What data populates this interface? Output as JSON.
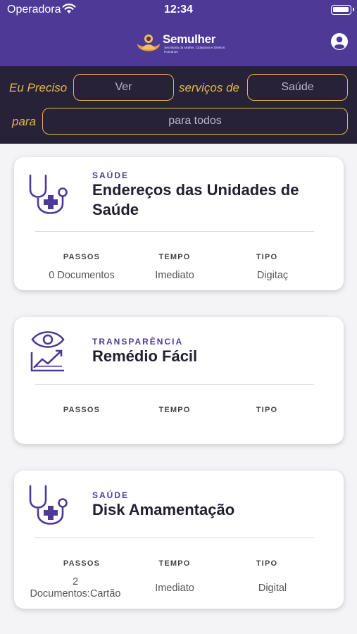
{
  "status_bar": {
    "carrier": "Operadora",
    "time": "12:34"
  },
  "header": {
    "logo_title": "Semulher",
    "logo_subtitle": "Secretaria da Mulher, Cidadania e Direitos Humanos",
    "brand_color": "#4e3a96",
    "profile_icon": "account-circle-icon"
  },
  "filter": {
    "label_need": "Eu Preciso",
    "action_value": "Ver",
    "label_services": "serviços de",
    "category_value": "Saúde",
    "label_for": "para",
    "audience_value": "para todos",
    "accent_color": "#e6b54b"
  },
  "cards": [
    {
      "icon": "stethoscope-plus-icon",
      "category": "SAÚDE",
      "title": "Endereços das Unidades de Saúde",
      "col_passos_label": "PASSOS",
      "col_tempo_label": "TEMPO",
      "col_tipo_label": "TIPO",
      "passos": "0 Documentos",
      "tempo": "Imediato",
      "tipo": "Digitaç"
    },
    {
      "icon": "eye-chart-icon",
      "category": "TRANSPARÊNCIA",
      "title": "Remédio Fácil",
      "col_passos_label": "PASSOS",
      "col_tempo_label": "TEMPO",
      "col_tipo_label": "TIPO",
      "passos": "",
      "tempo": "",
      "tipo": ""
    },
    {
      "icon": "stethoscope-plus-icon",
      "category": "SAÚDE",
      "title": "Disk Amamentação",
      "col_passos_label": "PASSOS",
      "col_tempo_label": "TEMPO",
      "col_tipo_label": "TIPO",
      "passos": "2\nDocumentos:Cartão",
      "tempo": "Imediato",
      "tipo": "Digital"
    }
  ]
}
